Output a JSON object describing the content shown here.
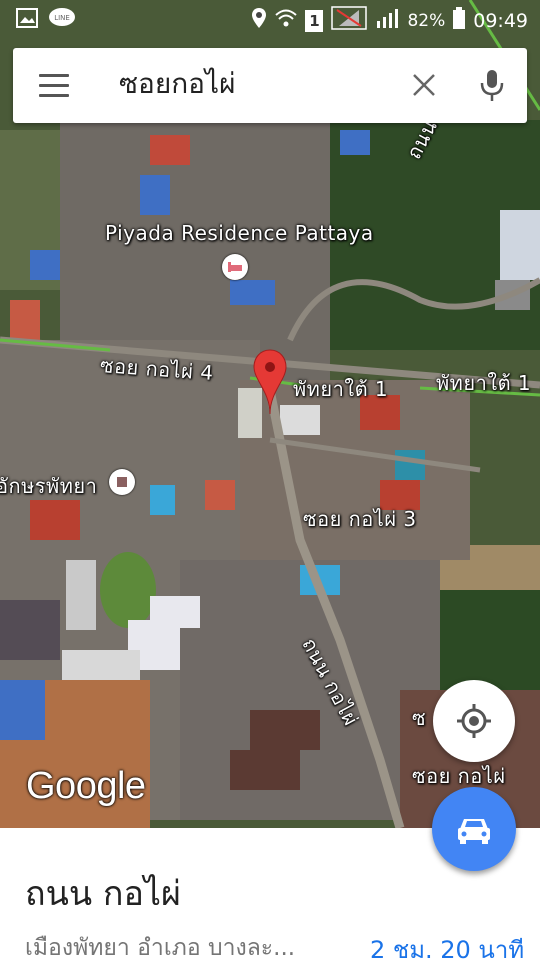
{
  "status_bar": {
    "battery": "82%",
    "time": "09:49",
    "sim_slot": "1"
  },
  "search": {
    "query": "ซอยกอไผ่"
  },
  "map": {
    "labels": {
      "poi": "Piyada Residence Pattaya",
      "soi4": "ซอย กอไผ่ 4",
      "south1": "พัทยาใต้ 1",
      "south1b": "พัทยาใต้ 1",
      "aksorn": "อักษรพัทยา",
      "soi3": "ซอย กอไผ่ 3",
      "road_main": "ถนน กอไผ่",
      "soi_right_a": "ซอย กอไผ่",
      "road_top": "ถนน",
      "soi_edge": "ซ"
    },
    "attribution": "Google"
  },
  "sheet": {
    "title": "ถนน กอไผ่",
    "subtitle": "เมืองพัทยา อำเภอ บางละ...",
    "eta": "2 ชม. 20 นาที"
  },
  "colors": {
    "accent": "#4285f4",
    "marker": "#e53935",
    "route_line": "#66bb44"
  }
}
